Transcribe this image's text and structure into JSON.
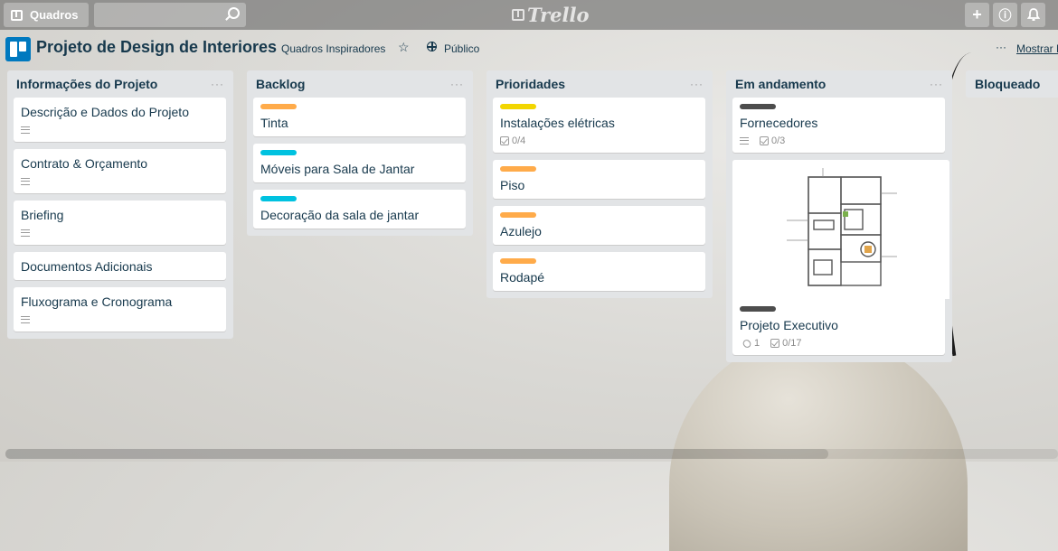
{
  "header": {
    "boards_label": "Quadros",
    "logo_text": "Trello",
    "add_symbol": "+",
    "info_symbol": "ⓘ",
    "bell_icon": "bell-icon"
  },
  "board": {
    "title": "Projeto de Design de Interiores",
    "team": "Quadros Inspiradores",
    "visibility": "Público",
    "show_menu": "Mostrar M",
    "menu_dots": "···"
  },
  "colors": {
    "orange": "#ffab4a",
    "cyan": "#00c2e0",
    "yellow": "#f2d600",
    "black": "#4d4d4d",
    "board_icon": "#0079bf"
  },
  "lists": [
    {
      "title": "Informações do Projeto",
      "menu": "···",
      "cards": [
        {
          "title": "Descrição e Dados do Projeto",
          "description": true
        },
        {
          "title": "Contrato & Orçamento",
          "description": true
        },
        {
          "title": "Briefing",
          "description": true
        },
        {
          "title": "Documentos Adicionais",
          "description": false
        },
        {
          "title": "Fluxograma e Cronograma",
          "description": true
        }
      ]
    },
    {
      "title": "Backlog",
      "menu": "···",
      "cards": [
        {
          "title": "Tinta",
          "label": "orange"
        },
        {
          "title": "Móveis para Sala de Jantar",
          "label": "cyan"
        },
        {
          "title": "Decoração da sala de jantar",
          "label": "cyan"
        }
      ]
    },
    {
      "title": "Prioridades",
      "menu": "···",
      "cards": [
        {
          "title": "Instalações elétricas",
          "label": "yellow",
          "checklist": "0/4"
        },
        {
          "title": "Piso",
          "label": "orange"
        },
        {
          "title": "Azulejo",
          "label": "orange"
        },
        {
          "title": "Rodapé",
          "label": "orange"
        }
      ]
    },
    {
      "title": "Em andamento",
      "menu": "···",
      "cards": [
        {
          "title": "Fornecedores",
          "label": "black",
          "description": true,
          "checklist": "0/3"
        },
        {
          "title": "Projeto Executivo",
          "label": "black",
          "attachments": "1",
          "checklist": "0/17",
          "cover": "floor-plan-image"
        }
      ]
    },
    {
      "title": "Bloqueado",
      "cards": []
    }
  ]
}
